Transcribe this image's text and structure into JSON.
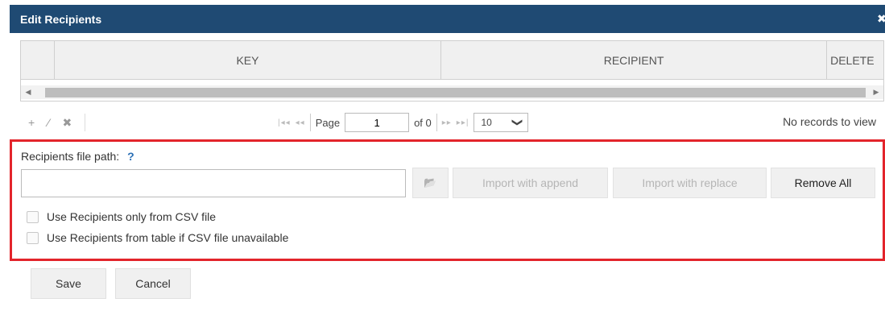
{
  "dialog": {
    "title": "Edit Recipients",
    "close_glyph": "✖"
  },
  "grid": {
    "columns": [
      "KEY",
      "RECIPIENT",
      "DELETE"
    ],
    "scroll_left": "◀",
    "scroll_right": "▶"
  },
  "pager": {
    "tools": {
      "add": "+",
      "edit": "⁄",
      "delete": "✖"
    },
    "first": "|◂◂",
    "prev": "◂◂",
    "page_label": "Page",
    "page_value": "1",
    "of_label": "of 0",
    "next": "▸▸",
    "last": "▸▸|",
    "rows_value": "10",
    "chevron": "❯",
    "records_text": "No records to view"
  },
  "import": {
    "path_label": "Recipients file path:",
    "help": "?",
    "path_value": "",
    "folder_glyph": "📂",
    "append_label": "Import with append",
    "replace_label": "Import with replace",
    "remove_label": "Remove All",
    "checkbox_csv_only": "Use Recipients only from CSV file",
    "checkbox_table_fallback": "Use Recipients from table if CSV file unavailable"
  },
  "footer": {
    "save_label": "Save",
    "cancel_label": "Cancel"
  }
}
